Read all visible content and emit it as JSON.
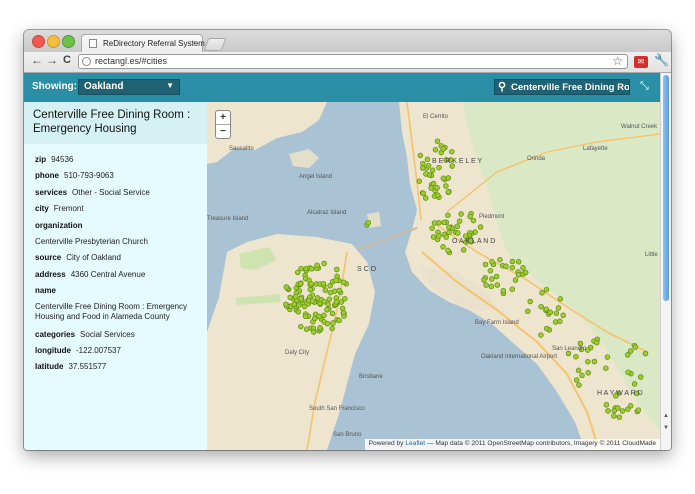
{
  "browser": {
    "tab_title": "ReDirectory Referral System",
    "tab_close": "×",
    "url": "rectangl.es/#cities",
    "back": "←",
    "forward": "→",
    "reload": "C",
    "star": "☆",
    "wrench": "🔧"
  },
  "appbar": {
    "showing_label": "Showing:",
    "city": "Oakland",
    "search_value": "Centerville Free Dining Room :",
    "caret": "▼",
    "mag": "⚲",
    "expand": "⤡"
  },
  "sidebar": {
    "title": "Centerville Free Dining Room : Emergency Housing",
    "fields": {
      "zip_label": "zip",
      "zip": "94536",
      "phone_label": "phone",
      "phone": "510-793-9063",
      "services_label": "services",
      "services": "Other - Social Service",
      "city_label": "city",
      "city": "Fremont",
      "organization_label": "organization",
      "organization": "Centerville Presbyterian Church",
      "source_label": "source",
      "source": "City of Oakland",
      "address_label": "address",
      "address": "4360 Central Avenue",
      "name_label": "name",
      "name": "Centerville Free Dining Room : Emergency Housing and Food in Alameda County",
      "categories_label": "categories",
      "categories": "Social Services",
      "longitude_label": "longitude",
      "longitude": "-122.007537",
      "latitude_label": "latitude",
      "latitude": "37.551577"
    }
  },
  "map": {
    "zoom_in": "+",
    "zoom_out": "−",
    "attribution_prefix": "Powered by",
    "attribution_link": "Leaflet",
    "attribution_rest": "— Map data © 2011 OpenStreetMap contributors, Imagery © 2011 CloudMade",
    "labels": {
      "el_cerrito": "El Cerrito",
      "walnut_creek": "Walnut Creek",
      "lafayette": "Lafayette",
      "orinda": "Orinda",
      "piedmont": "Piedmont",
      "sausalito": "Sausalito",
      "angel_island": "Angel Island",
      "alcatraz": "Alcatraz Island",
      "treasure_island": "Treasure Island",
      "berkeley": "B E R K E L E Y",
      "oakland": "O A K L A N D",
      "san_francisco": "S C O",
      "daly_city": "Daly City",
      "south_sf": "South San Francisco",
      "san_bruno": "San Bruno",
      "bay_farm": "Bay Farm Island",
      "oakland_airport": "Oakland International Airport",
      "hayward": "H A Y W A R D",
      "san_leandro": "San Leandro",
      "little": "Little",
      "brisbane": "Brisbane"
    },
    "marker_color": "#9ccc2e",
    "marker_stroke": "#5f8a12"
  }
}
